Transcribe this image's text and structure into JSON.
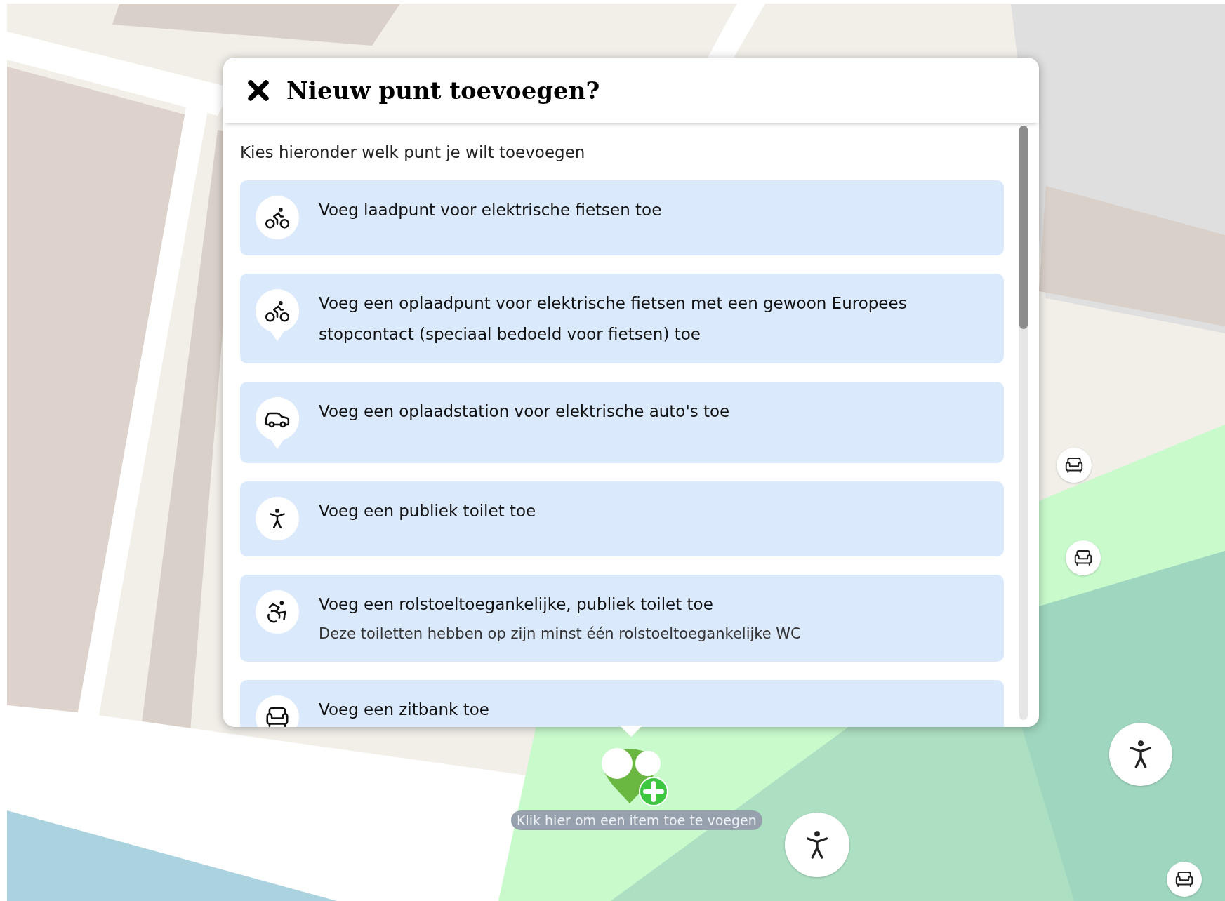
{
  "dialog": {
    "title": "Nieuw punt toevoegen?",
    "intro": "Kies hieronder welk punt je wilt toevoegen",
    "options": [
      {
        "label": "Voeg laadpunt voor elektrische fietsen toe"
      },
      {
        "label": "Voeg een oplaadpunt voor elektrische fietsen met een gewoon Europees stopcontact (speciaal bedoeld voor fietsen) toe"
      },
      {
        "label": "Voeg een oplaadstation voor elektrische auto's toe"
      },
      {
        "label": "Voeg een publiek toilet toe"
      },
      {
        "label": "Voeg een rolstoeltoegankelijke, publiek toilet toe",
        "description": "Deze toiletten hebben op zijn minst één rolstoeltoegankelijke WC"
      },
      {
        "label": "Voeg een zitbank toe"
      }
    ]
  },
  "map": {
    "add_hint": "Klik hier om een item toe te voegen"
  }
}
